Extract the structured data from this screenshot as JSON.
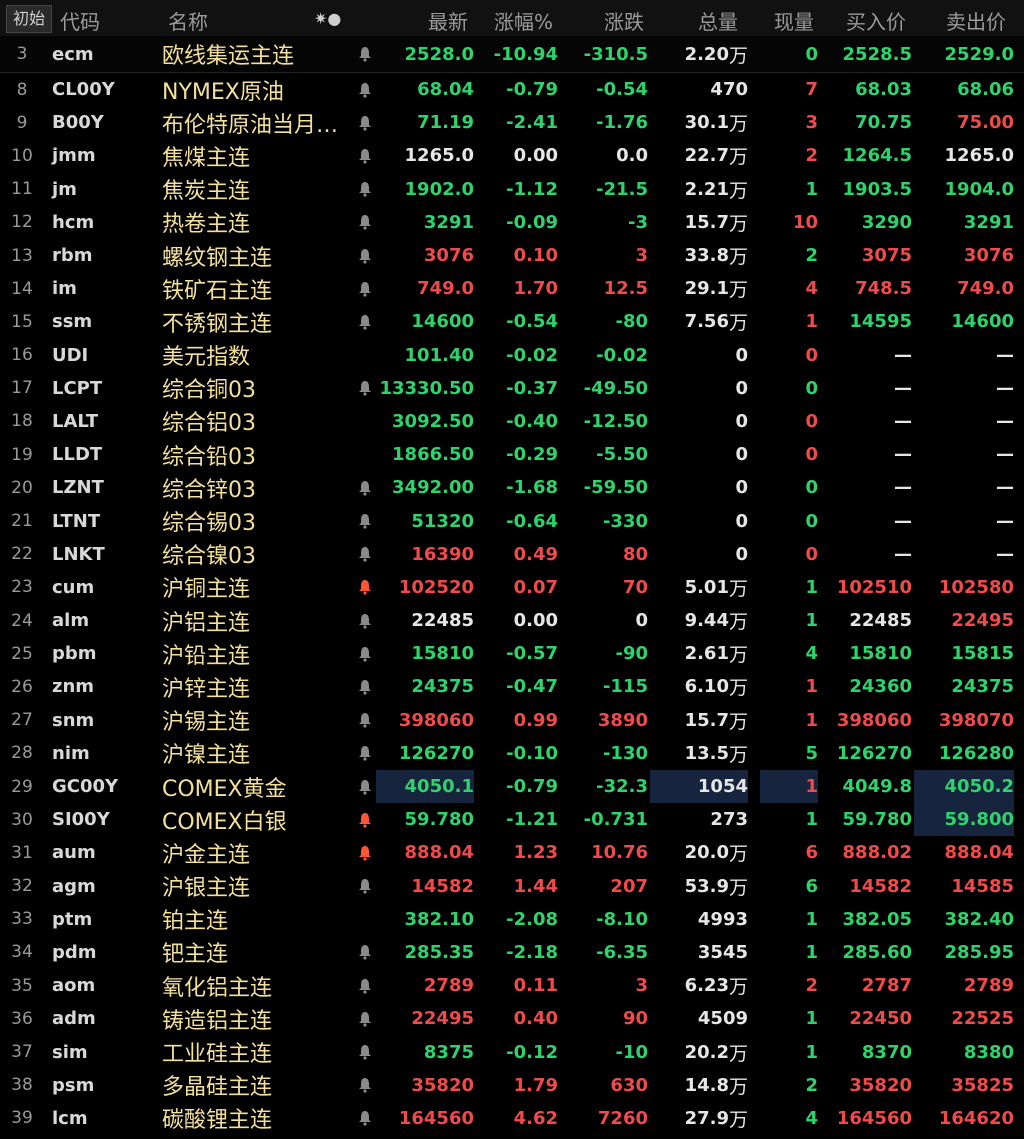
{
  "colors": {
    "up": "#f04a4a",
    "down": "#2fd36b",
    "flat": "#e6e6e6",
    "name": "#f3e09a",
    "bell_inactive": "#8a8a8a",
    "bell_active": "#ff5533",
    "highlight": "#17243d"
  },
  "header": {
    "start_label": "初始",
    "columns": {
      "code": "代码",
      "name": "名称",
      "tool_icons": "✷●",
      "last": "最新",
      "pct": "涨幅%",
      "chg": "涨跌",
      "vol": "总量",
      "cur": "现量",
      "bid": "买入价",
      "ask": "卖出价"
    }
  },
  "rows": [
    {
      "idx": "3",
      "code": "ecm",
      "name": "欧线集运主连",
      "bell": "inactive",
      "last": "2528.0",
      "pct": "-10.94",
      "chg": "-310.5",
      "vol": "2.20",
      "vol_unit": "万",
      "cur": "0",
      "bid": "2528.5",
      "ask": "2529.0",
      "last_dir": "down",
      "pct_dir": "down",
      "cur_dir": "down",
      "bid_dir": "down",
      "ask_dir": "down"
    },
    {
      "idx": "8",
      "code": "CL00Y",
      "name": "NYMEX原油",
      "bell": "inactive",
      "last": "68.04",
      "pct": "-0.79",
      "chg": "-0.54",
      "vol": "470",
      "vol_unit": "",
      "cur": "7",
      "bid": "68.03",
      "ask": "68.06",
      "last_dir": "down",
      "pct_dir": "down",
      "cur_dir": "up",
      "bid_dir": "down",
      "ask_dir": "down"
    },
    {
      "idx": "9",
      "code": "B00Y",
      "name": "布伦特原油当月…",
      "bell": "inactive",
      "last": "71.19",
      "pct": "-2.41",
      "chg": "-1.76",
      "vol": "30.1",
      "vol_unit": "万",
      "cur": "3",
      "bid": "70.75",
      "ask": "75.00",
      "last_dir": "down",
      "pct_dir": "down",
      "cur_dir": "up",
      "bid_dir": "down",
      "ask_dir": "up"
    },
    {
      "idx": "10",
      "code": "jmm",
      "name": "焦煤主连",
      "bell": "inactive",
      "last": "1265.0",
      "pct": "0.00",
      "chg": "0.0",
      "vol": "22.7",
      "vol_unit": "万",
      "cur": "2",
      "bid": "1264.5",
      "ask": "1265.0",
      "last_dir": "flat",
      "pct_dir": "flat",
      "cur_dir": "up",
      "bid_dir": "down",
      "ask_dir": "flat"
    },
    {
      "idx": "11",
      "code": "jm",
      "name": "焦炭主连",
      "bell": "inactive",
      "last": "1902.0",
      "pct": "-1.12",
      "chg": "-21.5",
      "vol": "2.21",
      "vol_unit": "万",
      "cur": "1",
      "bid": "1903.5",
      "ask": "1904.0",
      "last_dir": "down",
      "pct_dir": "down",
      "cur_dir": "down",
      "bid_dir": "down",
      "ask_dir": "down"
    },
    {
      "idx": "12",
      "code": "hcm",
      "name": "热卷主连",
      "bell": "inactive",
      "last": "3291",
      "pct": "-0.09",
      "chg": "-3",
      "vol": "15.7",
      "vol_unit": "万",
      "cur": "10",
      "bid": "3290",
      "ask": "3291",
      "last_dir": "down",
      "pct_dir": "down",
      "cur_dir": "up",
      "bid_dir": "down",
      "ask_dir": "down"
    },
    {
      "idx": "13",
      "code": "rbm",
      "name": "螺纹钢主连",
      "bell": "inactive",
      "last": "3076",
      "pct": "0.10",
      "chg": "3",
      "vol": "33.8",
      "vol_unit": "万",
      "cur": "2",
      "bid": "3075",
      "ask": "3076",
      "last_dir": "up",
      "pct_dir": "up",
      "cur_dir": "down",
      "bid_dir": "up",
      "ask_dir": "up"
    },
    {
      "idx": "14",
      "code": "im",
      "name": "铁矿石主连",
      "bell": "inactive",
      "last": "749.0",
      "pct": "1.70",
      "chg": "12.5",
      "vol": "29.1",
      "vol_unit": "万",
      "cur": "4",
      "bid": "748.5",
      "ask": "749.0",
      "last_dir": "up",
      "pct_dir": "up",
      "cur_dir": "up",
      "bid_dir": "up",
      "ask_dir": "up"
    },
    {
      "idx": "15",
      "code": "ssm",
      "name": "不锈钢主连",
      "bell": "inactive",
      "last": "14600",
      "pct": "-0.54",
      "chg": "-80",
      "vol": "7.56",
      "vol_unit": "万",
      "cur": "1",
      "bid": "14595",
      "ask": "14600",
      "last_dir": "down",
      "pct_dir": "down",
      "cur_dir": "up",
      "bid_dir": "down",
      "ask_dir": "down"
    },
    {
      "idx": "16",
      "code": "UDI",
      "name": "美元指数",
      "bell": "none",
      "last": "101.40",
      "pct": "-0.02",
      "chg": "-0.02",
      "vol": "0",
      "vol_unit": "",
      "cur": "0",
      "bid": "—",
      "ask": "—",
      "last_dir": "down",
      "pct_dir": "down",
      "cur_dir": "up",
      "bid_dir": "dash",
      "ask_dir": "dash"
    },
    {
      "idx": "17",
      "code": "LCPT",
      "name": "综合铜03",
      "bell": "inactive",
      "last": "13330.50",
      "pct": "-0.37",
      "chg": "-49.50",
      "vol": "0",
      "vol_unit": "",
      "cur": "0",
      "bid": "—",
      "ask": "—",
      "last_dir": "down",
      "pct_dir": "down",
      "cur_dir": "down",
      "bid_dir": "dash",
      "ask_dir": "dash"
    },
    {
      "idx": "18",
      "code": "LALT",
      "name": "综合铝03",
      "bell": "none",
      "last": "3092.50",
      "pct": "-0.40",
      "chg": "-12.50",
      "vol": "0",
      "vol_unit": "",
      "cur": "0",
      "bid": "—",
      "ask": "—",
      "last_dir": "down",
      "pct_dir": "down",
      "cur_dir": "up",
      "bid_dir": "dash",
      "ask_dir": "dash"
    },
    {
      "idx": "19",
      "code": "LLDT",
      "name": "综合铅03",
      "bell": "none",
      "last": "1866.50",
      "pct": "-0.29",
      "chg": "-5.50",
      "vol": "0",
      "vol_unit": "",
      "cur": "0",
      "bid": "—",
      "ask": "—",
      "last_dir": "down",
      "pct_dir": "down",
      "cur_dir": "up",
      "bid_dir": "dash",
      "ask_dir": "dash"
    },
    {
      "idx": "20",
      "code": "LZNT",
      "name": "综合锌03",
      "bell": "inactive",
      "last": "3492.00",
      "pct": "-1.68",
      "chg": "-59.50",
      "vol": "0",
      "vol_unit": "",
      "cur": "0",
      "bid": "—",
      "ask": "—",
      "last_dir": "down",
      "pct_dir": "down",
      "cur_dir": "down",
      "bid_dir": "dash",
      "ask_dir": "dash"
    },
    {
      "idx": "21",
      "code": "LTNT",
      "name": "综合锡03",
      "bell": "inactive",
      "last": "51320",
      "pct": "-0.64",
      "chg": "-330",
      "vol": "0",
      "vol_unit": "",
      "cur": "0",
      "bid": "—",
      "ask": "—",
      "last_dir": "down",
      "pct_dir": "down",
      "cur_dir": "down",
      "bid_dir": "dash",
      "ask_dir": "dash"
    },
    {
      "idx": "22",
      "code": "LNKT",
      "name": "综合镍03",
      "bell": "inactive",
      "last": "16390",
      "pct": "0.49",
      "chg": "80",
      "vol": "0",
      "vol_unit": "",
      "cur": "0",
      "bid": "—",
      "ask": "—",
      "last_dir": "up",
      "pct_dir": "up",
      "cur_dir": "up",
      "bid_dir": "dash",
      "ask_dir": "dash"
    },
    {
      "idx": "23",
      "code": "cum",
      "name": "沪铜主连",
      "bell": "active",
      "last": "102520",
      "pct": "0.07",
      "chg": "70",
      "vol": "5.01",
      "vol_unit": "万",
      "cur": "1",
      "bid": "102510",
      "ask": "102580",
      "last_dir": "up",
      "pct_dir": "up",
      "cur_dir": "down",
      "bid_dir": "up",
      "ask_dir": "up"
    },
    {
      "idx": "24",
      "code": "alm",
      "name": "沪铝主连",
      "bell": "inactive",
      "last": "22485",
      "pct": "0.00",
      "chg": "0",
      "vol": "9.44",
      "vol_unit": "万",
      "cur": "1",
      "bid": "22485",
      "ask": "22495",
      "last_dir": "flat",
      "pct_dir": "flat",
      "cur_dir": "down",
      "bid_dir": "flat",
      "ask_dir": "up"
    },
    {
      "idx": "25",
      "code": "pbm",
      "name": "沪铅主连",
      "bell": "inactive",
      "last": "15810",
      "pct": "-0.57",
      "chg": "-90",
      "vol": "2.61",
      "vol_unit": "万",
      "cur": "4",
      "bid": "15810",
      "ask": "15815",
      "last_dir": "down",
      "pct_dir": "down",
      "cur_dir": "down",
      "bid_dir": "down",
      "ask_dir": "down"
    },
    {
      "idx": "26",
      "code": "znm",
      "name": "沪锌主连",
      "bell": "inactive",
      "last": "24375",
      "pct": "-0.47",
      "chg": "-115",
      "vol": "6.10",
      "vol_unit": "万",
      "cur": "1",
      "bid": "24360",
      "ask": "24375",
      "last_dir": "down",
      "pct_dir": "down",
      "cur_dir": "up",
      "bid_dir": "down",
      "ask_dir": "down"
    },
    {
      "idx": "27",
      "code": "snm",
      "name": "沪锡主连",
      "bell": "inactive",
      "last": "398060",
      "pct": "0.99",
      "chg": "3890",
      "vol": "15.7",
      "vol_unit": "万",
      "cur": "1",
      "bid": "398060",
      "ask": "398070",
      "last_dir": "up",
      "pct_dir": "up",
      "cur_dir": "up",
      "bid_dir": "up",
      "ask_dir": "up"
    },
    {
      "idx": "28",
      "code": "nim",
      "name": "沪镍主连",
      "bell": "inactive",
      "last": "126270",
      "pct": "-0.10",
      "chg": "-130",
      "vol": "13.5",
      "vol_unit": "万",
      "cur": "5",
      "bid": "126270",
      "ask": "126280",
      "last_dir": "down",
      "pct_dir": "down",
      "cur_dir": "down",
      "bid_dir": "down",
      "ask_dir": "down"
    },
    {
      "idx": "29",
      "code": "GC00Y",
      "name": "COMEX黄金",
      "bell": "inactive",
      "last": "4050.1",
      "pct": "-0.79",
      "chg": "-32.3",
      "vol": "1054",
      "vol_unit": "",
      "cur": "1",
      "bid": "4049.8",
      "ask": "4050.2",
      "last_dir": "down",
      "pct_dir": "down",
      "cur_dir": "up",
      "bid_dir": "down",
      "ask_dir": "down",
      "hl": [
        "last",
        "vol",
        "cur",
        "ask"
      ]
    },
    {
      "idx": "30",
      "code": "SI00Y",
      "name": "COMEX白银",
      "bell": "active",
      "last": "59.780",
      "pct": "-1.21",
      "chg": "-0.731",
      "vol": "273",
      "vol_unit": "",
      "cur": "1",
      "bid": "59.780",
      "ask": "59.800",
      "last_dir": "down",
      "pct_dir": "down",
      "cur_dir": "down",
      "bid_dir": "down",
      "ask_dir": "down",
      "hl": [
        "ask"
      ]
    },
    {
      "idx": "31",
      "code": "aum",
      "name": "沪金主连",
      "bell": "active",
      "last": "888.04",
      "pct": "1.23",
      "chg": "10.76",
      "vol": "20.0",
      "vol_unit": "万",
      "cur": "6",
      "bid": "888.02",
      "ask": "888.04",
      "last_dir": "up",
      "pct_dir": "up",
      "cur_dir": "up",
      "bid_dir": "up",
      "ask_dir": "up"
    },
    {
      "idx": "32",
      "code": "agm",
      "name": "沪银主连",
      "bell": "inactive",
      "last": "14582",
      "pct": "1.44",
      "chg": "207",
      "vol": "53.9",
      "vol_unit": "万",
      "cur": "6",
      "bid": "14582",
      "ask": "14585",
      "last_dir": "up",
      "pct_dir": "up",
      "cur_dir": "down",
      "bid_dir": "up",
      "ask_dir": "up"
    },
    {
      "idx": "33",
      "code": "ptm",
      "name": "铂主连",
      "bell": "none",
      "last": "382.10",
      "pct": "-2.08",
      "chg": "-8.10",
      "vol": "4993",
      "vol_unit": "",
      "cur": "1",
      "bid": "382.05",
      "ask": "382.40",
      "last_dir": "down",
      "pct_dir": "down",
      "cur_dir": "down",
      "bid_dir": "down",
      "ask_dir": "down"
    },
    {
      "idx": "34",
      "code": "pdm",
      "name": "钯主连",
      "bell": "inactive",
      "last": "285.35",
      "pct": "-2.18",
      "chg": "-6.35",
      "vol": "3545",
      "vol_unit": "",
      "cur": "1",
      "bid": "285.60",
      "ask": "285.95",
      "last_dir": "down",
      "pct_dir": "down",
      "cur_dir": "down",
      "bid_dir": "down",
      "ask_dir": "down"
    },
    {
      "idx": "35",
      "code": "aom",
      "name": "氧化铝主连",
      "bell": "inactive",
      "last": "2789",
      "pct": "0.11",
      "chg": "3",
      "vol": "6.23",
      "vol_unit": "万",
      "cur": "2",
      "bid": "2787",
      "ask": "2789",
      "last_dir": "up",
      "pct_dir": "up",
      "cur_dir": "up",
      "bid_dir": "up",
      "ask_dir": "up"
    },
    {
      "idx": "36",
      "code": "adm",
      "name": "铸造铝主连",
      "bell": "inactive",
      "last": "22495",
      "pct": "0.40",
      "chg": "90",
      "vol": "4509",
      "vol_unit": "",
      "cur": "1",
      "bid": "22450",
      "ask": "22525",
      "last_dir": "up",
      "pct_dir": "up",
      "cur_dir": "down",
      "bid_dir": "up",
      "ask_dir": "up"
    },
    {
      "idx": "37",
      "code": "sim",
      "name": "工业硅主连",
      "bell": "inactive",
      "last": "8375",
      "pct": "-0.12",
      "chg": "-10",
      "vol": "20.2",
      "vol_unit": "万",
      "cur": "1",
      "bid": "8370",
      "ask": "8380",
      "last_dir": "down",
      "pct_dir": "down",
      "cur_dir": "down",
      "bid_dir": "down",
      "ask_dir": "down"
    },
    {
      "idx": "38",
      "code": "psm",
      "name": "多晶硅主连",
      "bell": "inactive",
      "last": "35820",
      "pct": "1.79",
      "chg": "630",
      "vol": "14.8",
      "vol_unit": "万",
      "cur": "2",
      "bid": "35820",
      "ask": "35825",
      "last_dir": "up",
      "pct_dir": "up",
      "cur_dir": "down",
      "bid_dir": "up",
      "ask_dir": "up"
    },
    {
      "idx": "39",
      "code": "lcm",
      "name": "碳酸锂主连",
      "bell": "inactive",
      "last": "164560",
      "pct": "4.62",
      "chg": "7260",
      "vol": "27.9",
      "vol_unit": "万",
      "cur": "4",
      "bid": "164560",
      "ask": "164620",
      "last_dir": "up",
      "pct_dir": "up",
      "cur_dir": "down",
      "bid_dir": "up",
      "ask_dir": "up"
    }
  ]
}
